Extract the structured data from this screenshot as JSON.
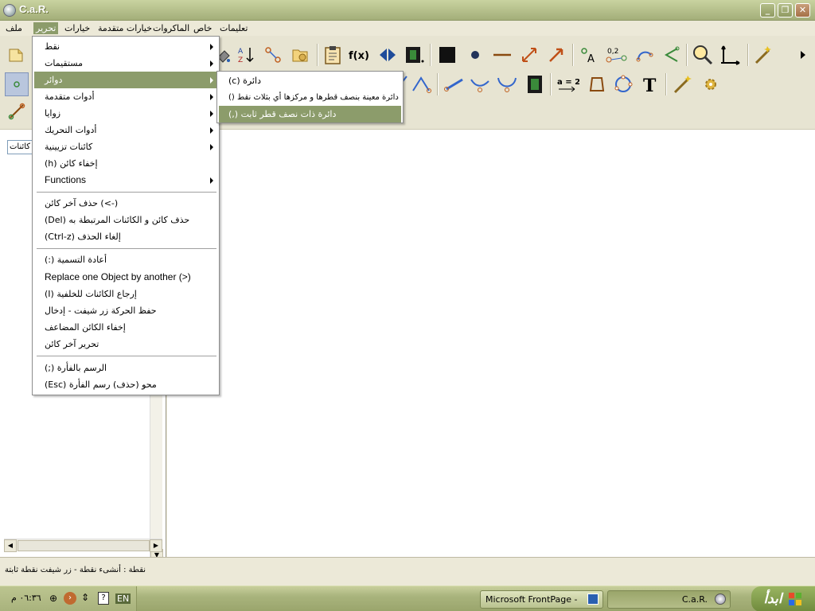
{
  "window": {
    "title": "C.a.R."
  },
  "menubar": {
    "file": "ملف",
    "edit": "تحرير",
    "options": "خيارات",
    "advanced_options": "خيارات متقدمة",
    "macros": "الماكروات",
    "special": "خاص",
    "help": "تعليمات"
  },
  "edit_menu": {
    "items": [
      {
        "label": "نقط",
        "submenu": true
      },
      {
        "label": "مستقيمات",
        "submenu": true
      },
      {
        "label": "دوائر",
        "submenu": true,
        "highlighted": true
      },
      {
        "label": "أدوات متقدمة",
        "submenu": true
      },
      {
        "label": "زوايا",
        "submenu": true
      },
      {
        "label": "أدوات التحريك",
        "submenu": true
      },
      {
        "label": "كائنات تزيينية",
        "submenu": true
      },
      {
        "label": "(h) إخفاء كائن",
        "submenu": false
      },
      {
        "label": "Functions",
        "submenu": true
      }
    ],
    "group2": [
      {
        "label": "حذف آخر كائن      (<-)"
      },
      {
        "label": "(Del) حذف كائن و الكائنات المرتبطة به"
      },
      {
        "label": "(Ctrl-z)        إلغاء الحذف"
      }
    ],
    "group3": [
      {
        "label": "(:) أعادة التسمية"
      },
      {
        "label": "Replace one Object by another (>)"
      },
      {
        "label": "(I) إرجاع الكائنات للخلفية"
      },
      {
        "label": "حفظ الحركة زر شيفت - إدخال"
      },
      {
        "label": "إخفاء الكائن المضاعف"
      },
      {
        "label": "تحرير آخر كائن"
      }
    ],
    "group4": [
      {
        "label": "(;) الرسم بالفأرة"
      },
      {
        "label": "(Esc)       محو (حذف) رسم الفأرة"
      }
    ]
  },
  "circles_submenu": {
    "items": [
      {
        "label": "(c) دائرة"
      },
      {
        "label": "() دائرة معينة بنصف قطرها و مركزها أي بثلاث نقط"
      },
      {
        "label": "(,) دائرة ذات نصف قطر ثابت",
        "highlighted": true
      }
    ]
  },
  "left_panel": {
    "object_select": "كائنات"
  },
  "status": {
    "text": "نقطة : أنشىء نقطة - زر شيفت نقطة ثابتة"
  },
  "taskbar": {
    "start_label": "ابدأ",
    "task_frontpage": "Microsoft FrontPage - ...",
    "task_car": "C.a.R.",
    "clock": "٠٦:٣٦ م",
    "language": "EN"
  },
  "colors": {
    "highlight": "#8c9c6b",
    "titlebar": "#a3ae79",
    "taskbar": "#a9b47d"
  }
}
